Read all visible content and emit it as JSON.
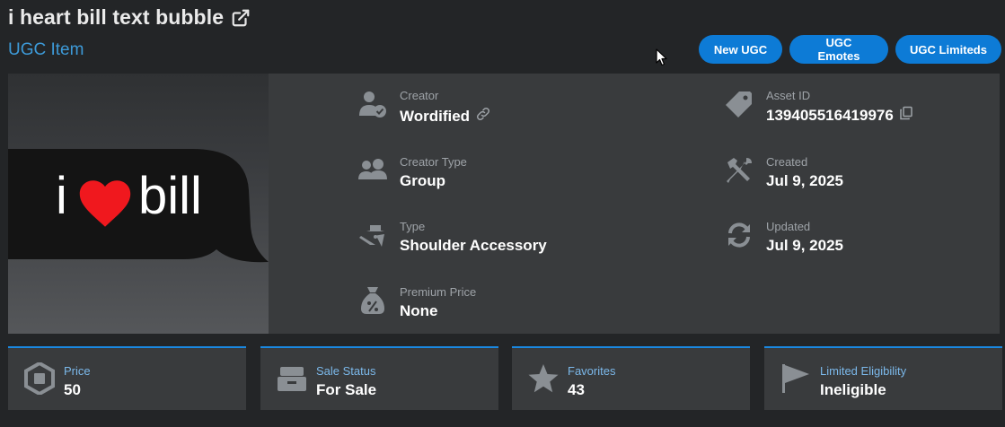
{
  "header": {
    "title": "i heart bill text bubble",
    "subtitle": "UGC Item",
    "buttons": [
      "New UGC",
      "UGC Emotes",
      "UGC Limiteds"
    ]
  },
  "thumbnail": {
    "left_text": "i",
    "right_text": "bill",
    "heart_color": "#f0181e",
    "bubble_color": "#141414"
  },
  "details": {
    "creator": {
      "label": "Creator",
      "value": "Wordified",
      "icon": "creator-verified-icon"
    },
    "creator_type": {
      "label": "Creator Type",
      "value": "Group",
      "icon": "group-icon"
    },
    "type": {
      "label": "Type",
      "value": "Shoulder Accessory",
      "icon": "accessory-icon"
    },
    "premium_price": {
      "label": "Premium Price",
      "value": "None",
      "icon": "money-bag-icon"
    },
    "asset_id": {
      "label": "Asset ID",
      "value": "139405516419976",
      "icon": "tag-icon"
    },
    "created": {
      "label": "Created",
      "value": "Jul 9, 2025",
      "icon": "tools-icon"
    },
    "updated": {
      "label": "Updated",
      "value": "Jul 9, 2025",
      "icon": "refresh-icon"
    }
  },
  "stats": [
    {
      "label": "Price",
      "value": "50",
      "icon": "robux-icon"
    },
    {
      "label": "Sale Status",
      "value": "For Sale",
      "icon": "register-icon"
    },
    {
      "label": "Favorites",
      "value": "43",
      "icon": "star-icon"
    },
    {
      "label": "Limited Eligibility",
      "value": "Ineligible",
      "icon": "flag-icon"
    }
  ],
  "colors": {
    "background": "#232527",
    "card": "#393b3d",
    "accent": "#0d7bd6",
    "subtitle": "#3d9ad8",
    "stat_label": "#7bb8ea"
  }
}
